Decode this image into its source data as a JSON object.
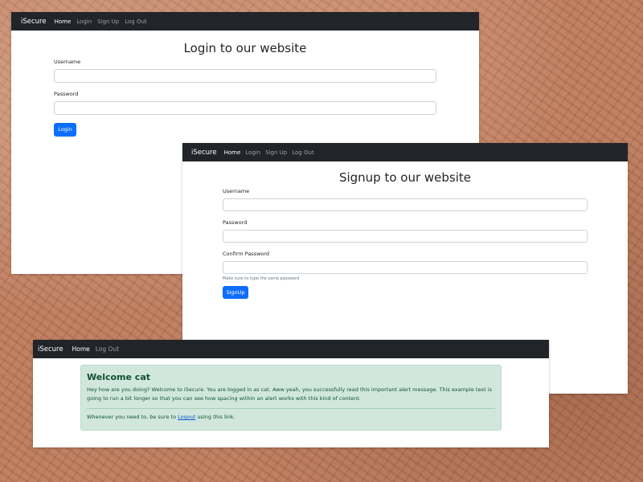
{
  "login_window": {
    "navbar": {
      "brand": "iSecure",
      "links": [
        "Home",
        "Login",
        "Sign Up",
        "Log Out"
      ]
    },
    "title": "Login to our website",
    "username_label": "Username",
    "username_value": "",
    "password_label": "Password",
    "password_value": "",
    "submit_label": "Login"
  },
  "signup_window": {
    "navbar": {
      "brand": "iSecure",
      "links": [
        "Home",
        "Login",
        "Sign Up",
        "Log Out"
      ]
    },
    "title": "Signup to our website",
    "username_label": "Username",
    "username_value": "",
    "password_label": "Password",
    "password_value": "",
    "confirm_label": "Confirm Password",
    "confirm_value": "",
    "help_text": "Make sure to type the same password",
    "submit_label": "SignUp"
  },
  "welcome_window": {
    "navbar": {
      "brand": "iSecure",
      "links": [
        "Home",
        "Log Out"
      ]
    },
    "alert": {
      "heading": "Welcome cat",
      "body": "Hey how are you doing? Welcome to iSecure. You are logged in as cat. Aww yeah, you successfully read this important alert message. This example text is going to run a bit longer so that you can see how spacing within an alert works with this kind of content.",
      "footer_before": "Whenever you need to, be sure to ",
      "footer_link": "Logout",
      "footer_after": " using this link."
    }
  },
  "colors": {
    "navbar_bg": "#212529",
    "primary_button": "#0d6efd",
    "alert_bg": "#d1e7dd",
    "alert_text": "#0f5132",
    "background": "#b9785a"
  }
}
